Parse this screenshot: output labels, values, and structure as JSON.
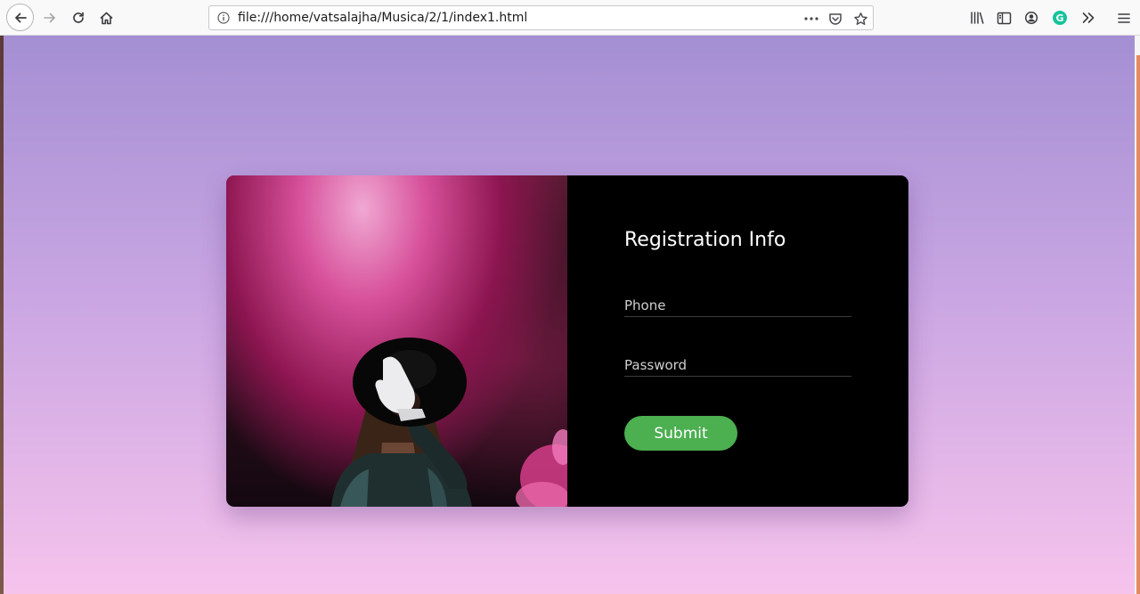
{
  "browser": {
    "url": "file:///home/vatsalajha/Musica/2/1/index1.html",
    "toolbar_icons": [
      "back-arrow-icon",
      "forward-arrow-icon",
      "reload-icon",
      "home-icon",
      "page-info-icon",
      "page-actions-icon",
      "pocket-icon",
      "bookmark-star-icon",
      "library-icon",
      "sidebar-icon",
      "account-icon",
      "grammarly-icon",
      "overflow-chevrons-icon",
      "hamburger-menu-icon"
    ],
    "grammarly_letter": "G"
  },
  "page": {
    "gradient_top": "#a48fd3",
    "gradient_bottom": "#f6c3ec"
  },
  "form": {
    "title": "Registration Info",
    "phone_placeholder": "Phone",
    "password_placeholder": "Password",
    "submit_label": "Submit",
    "submit_color": "#4caf50",
    "panel_color": "#000000"
  }
}
